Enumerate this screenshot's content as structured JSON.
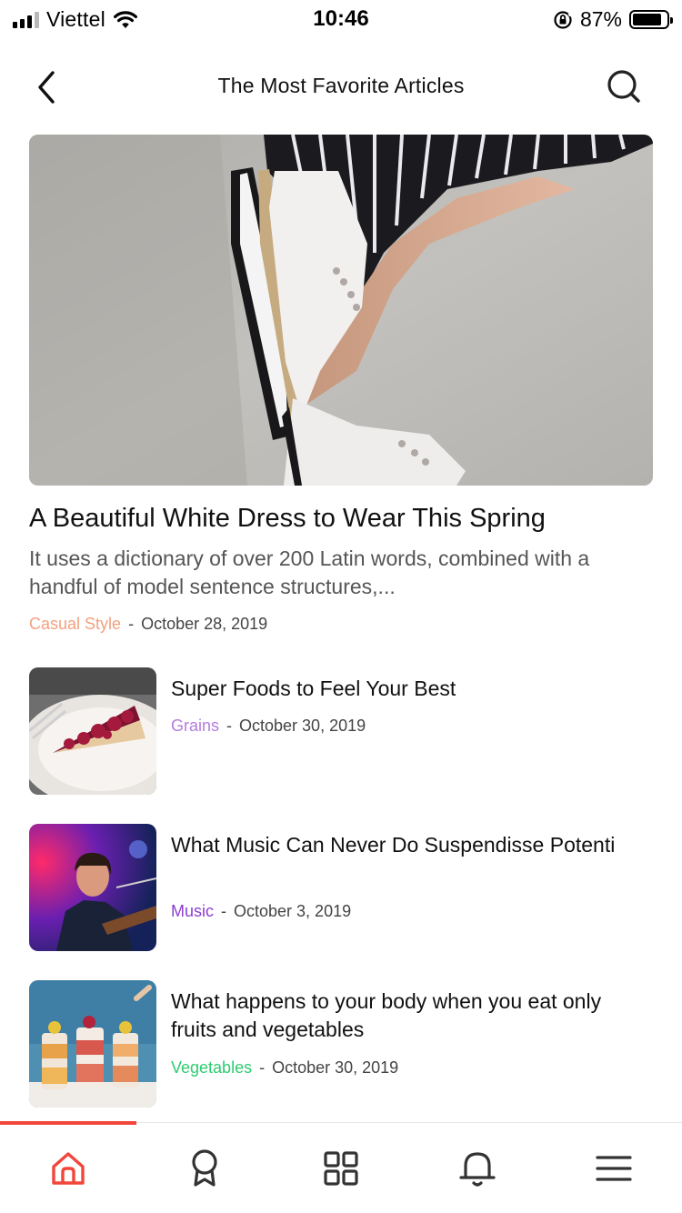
{
  "status_bar": {
    "carrier": "Viettel",
    "time": "10:46",
    "battery": "87%",
    "battery_level": 0.87
  },
  "header": {
    "title": "The Most Favorite Articles",
    "back_icon": "chevron-left-icon",
    "search_icon": "search-icon"
  },
  "featured": {
    "title": "A Beautiful White Dress to Wear This Spring",
    "excerpt": "It uses a dictionary of over 200 Latin words, combined with a handful of model sentence structures,...",
    "category": "Casual Style",
    "category_color": "#f5a07e",
    "separator": "-",
    "date": "October 28, 2019"
  },
  "articles": [
    {
      "title": "Super Foods to Feel Your Best",
      "category": "Grains",
      "category_color": "#b57be0",
      "separator": "-",
      "date": "October 30, 2019"
    },
    {
      "title": "What Music Can Never Do Suspendisse Potenti",
      "category": "Music",
      "category_color": "#8a3fd1",
      "separator": "-",
      "date": "October 3, 2019"
    },
    {
      "title": "What happens to your body when you eat only fruits and vegetables",
      "category": "Vegetables",
      "category_color": "#2ecc71",
      "separator": "-",
      "date": "October 30, 2019"
    }
  ],
  "tab_bar": {
    "accent": "#f2463c",
    "tabs": [
      {
        "icon": "home-icon",
        "active": true
      },
      {
        "icon": "award-icon",
        "active": false
      },
      {
        "icon": "grid-icon",
        "active": false
      },
      {
        "icon": "bell-icon",
        "active": false
      },
      {
        "icon": "menu-icon",
        "active": false
      }
    ]
  }
}
